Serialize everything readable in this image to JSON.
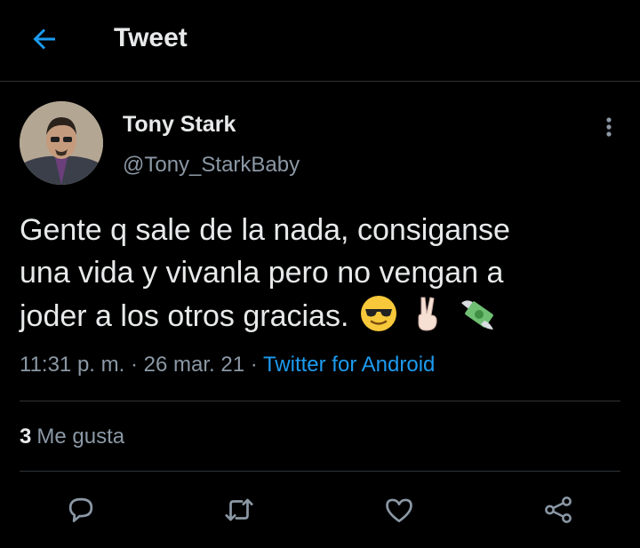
{
  "header": {
    "title": "Tweet"
  },
  "tweet": {
    "name": "Tony Stark",
    "handle": "@Tony_StarkBaby",
    "text_lines": [
      "Gente q sale de la nada, consiganse",
      "una vida y vivanla pero no vengan a",
      "joder a los otros gracias."
    ],
    "emojis": [
      "sunglasses-emoji",
      "victory-hand-emoji",
      "money-with-wings-emoji"
    ],
    "time": "11:31 p. m.",
    "separator": "·",
    "date": "26 mar. 21",
    "app": "Twitter for Android",
    "likes_count": "3",
    "likes_label": "Me gusta"
  },
  "colors": {
    "accent": "#1d9bf0",
    "muted": "#8b98a5",
    "background": "#000000"
  },
  "actions": [
    "reply-icon",
    "retweet-icon",
    "like-icon",
    "share-icon"
  ]
}
